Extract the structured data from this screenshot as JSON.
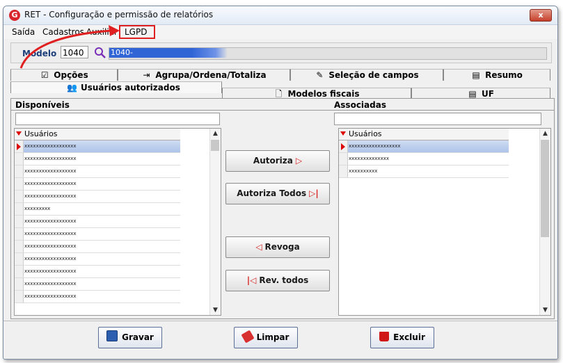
{
  "window": {
    "title": "RET - Configuração e permissão de relatórios",
    "close_label": "x"
  },
  "menu": {
    "items": [
      "Saída",
      "Cadastros",
      "Auxiliar",
      "LGPD"
    ]
  },
  "modelo": {
    "label": "Modelo",
    "code": "1040",
    "description": "1040-"
  },
  "tabs": {
    "row1": [
      {
        "label": "Opções",
        "icon": "check-icon"
      },
      {
        "label": "Agrupa/Ordena/Totaliza",
        "icon": "group-icon"
      },
      {
        "label": "Seleção de campos",
        "icon": "pencil-icon"
      },
      {
        "label": "Resumo",
        "icon": "document-icon"
      }
    ],
    "row2": [
      {
        "label": "Usuários autorizados",
        "icon": "users-icon"
      },
      {
        "label": "Modelos fiscais",
        "icon": "page-icon"
      },
      {
        "label": "UF",
        "icon": "document-icon"
      }
    ]
  },
  "available": {
    "title": "Disponíveis",
    "column": "Usuários",
    "rows": [
      "xxxxxxxxxxxxxxxxxx",
      "xxxxxxxxxxxxxxxxxx",
      "xxxxxxxxxxxxxxxxxx",
      "xxxxxxxxxxxxxxxxxx",
      "xxxxxxxxxxxxxxxxxx",
      "xxxxxxxxx",
      "xxxxxxxxxxxxxxxxxx",
      "xxxxxxxxxxxxxxxxxx",
      "xxxxxxxxxxxxxxxxxx",
      "xxxxxxxxxxxxxxxxxx",
      "xxxxxxxxxxxxxxxxxx",
      "xxxxxxxxxxxxxxxxxx",
      "xxxxxxxxxxxxxxxxxx"
    ]
  },
  "associated": {
    "title": "Associadas",
    "column": "Usuários",
    "rows": [
      "xxxxxxxxxxxxxxxxxx",
      "xxxxxxxxxxxxxx",
      "xxxxxxxxxx"
    ]
  },
  "actions": {
    "authorize": "Autoriza",
    "authorize_all": "Autoriza Todos",
    "revoke": "Revoga",
    "revoke_all": "Rev. todos"
  },
  "footer": {
    "save": "Gravar",
    "clear": "Limpar",
    "delete": "Excluir"
  },
  "colors": {
    "accent_red": "#e02020",
    "selection_blue": "#3165d6"
  }
}
